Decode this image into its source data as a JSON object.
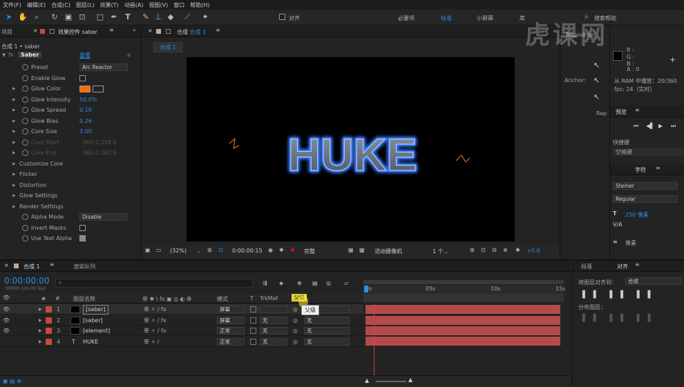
{
  "menu": [
    "文件(F)",
    "编辑(E)",
    "合成(C)",
    "图层(L)",
    "效果(T)",
    "动画(A)",
    "视图(V)",
    "窗口",
    "帮助(H)"
  ],
  "toolbar": {
    "snap_label": "对齐",
    "workspaces": [
      "必要项",
      "标准",
      "小屏幕",
      "库"
    ],
    "search_placeholder": "搜索帮助"
  },
  "left_panel": {
    "tab_project": "项目",
    "tab_effects": "效果控件 saber",
    "breadcrumb": "合成 1 • saber",
    "effect_name": "Saber",
    "reset": "重置",
    "fx": "fx",
    "rows": [
      {
        "label": "Preset",
        "value": "Arc Reactor",
        "type": "dropdown"
      },
      {
        "label": "Enable Glow",
        "type": "checkbox"
      },
      {
        "label": "Glow Color",
        "type": "color",
        "color": "#ff6a00"
      },
      {
        "label": "Glow Intensity",
        "value": "50.0%",
        "type": "number"
      },
      {
        "label": "Glow Spread",
        "value": "0.10",
        "type": "number"
      },
      {
        "label": "Glow Bias",
        "value": "0.26",
        "type": "number"
      },
      {
        "label": "Core Size",
        "value": "3.00",
        "type": "number"
      },
      {
        "label": "Core Start",
        "value": "960.0,318.0",
        "type": "disabled"
      },
      {
        "label": "Core End",
        "value": "960.0,162.0",
        "type": "disabled"
      },
      {
        "label": "Customize Core",
        "type": "group"
      },
      {
        "label": "Flicker",
        "type": "group"
      },
      {
        "label": "Distortion",
        "type": "group"
      },
      {
        "label": "Glow Settings",
        "type": "group"
      },
      {
        "label": "Render Settings",
        "type": "group"
      },
      {
        "label": "Alpha Mode",
        "value": "Disable",
        "type": "dropdown"
      },
      {
        "label": "Invert Masks",
        "type": "checkbox"
      },
      {
        "label": "Use Text Alpha",
        "type": "checkbox_checked"
      }
    ]
  },
  "comp": {
    "tab": "合成 1",
    "subtab": "合成 1",
    "title_text": "HUKE",
    "zoom": "(32%)",
    "timecode": "0:00:00:15",
    "quality": "完整",
    "camera": "活动摄像机",
    "views": "1 个...",
    "exposure": "+0.0"
  },
  "center_side": {
    "reposition": "Reposition",
    "anchor": "Anchor:",
    "rep": "Rep"
  },
  "right_panel": {
    "info": {
      "r": "R :",
      "g": "G :",
      "b": "B :",
      "a": "A : 0",
      "ram": "从 RAM 中播放：20/360",
      "fps": "fps: 24（实时）"
    },
    "preview_tab": "预览",
    "shortcut_label": "快捷键",
    "shortcut_value": "空格键",
    "char_tab": "字符",
    "font": "Steiner",
    "style": "Regular",
    "size": "250 像素",
    "tracking_unit": "像素",
    "align_tab": "对齐",
    "para_tab": "段落",
    "align_to_label": "将图层对齐到：",
    "align_to_value": "合成",
    "distribute_label": "分布图层："
  },
  "timeline": {
    "tab": "合成 1",
    "render_queue": "渲染队列",
    "timecode": "0:00:00:00",
    "timecode_sub": "00000 (24.00 fps)",
    "columns": {
      "num": "#",
      "name": "图层名称",
      "mode": "模式",
      "t": "T",
      "trkmat": "TrkMat",
      "parent": "父级"
    },
    "tooltip": "父级",
    "ruler": [
      "0s",
      "05s",
      "10s",
      "15s"
    ],
    "layers": [
      {
        "num": "1",
        "name": "[saber]",
        "mode": "屏幕",
        "trkmat": "",
        "parent": "无",
        "selected": true
      },
      {
        "num": "2",
        "name": "[saber]",
        "mode": "屏幕",
        "trkmat": "无",
        "parent": "无",
        "selected": false
      },
      {
        "num": "3",
        "name": "[element]",
        "mode": "正常",
        "trkmat": "无",
        "parent": "无",
        "selected": false
      },
      {
        "num": "4",
        "name": "HUKE",
        "mode": "正常",
        "trkmat": "无",
        "parent": "无",
        "selected": false,
        "text": true
      }
    ]
  },
  "watermark": "虎课网",
  "colors": {
    "accent": "#2d8ceb",
    "layer_bar": "#b34b4b",
    "label_red": "#c84a3c",
    "glow_blue": "#3a7bff"
  }
}
